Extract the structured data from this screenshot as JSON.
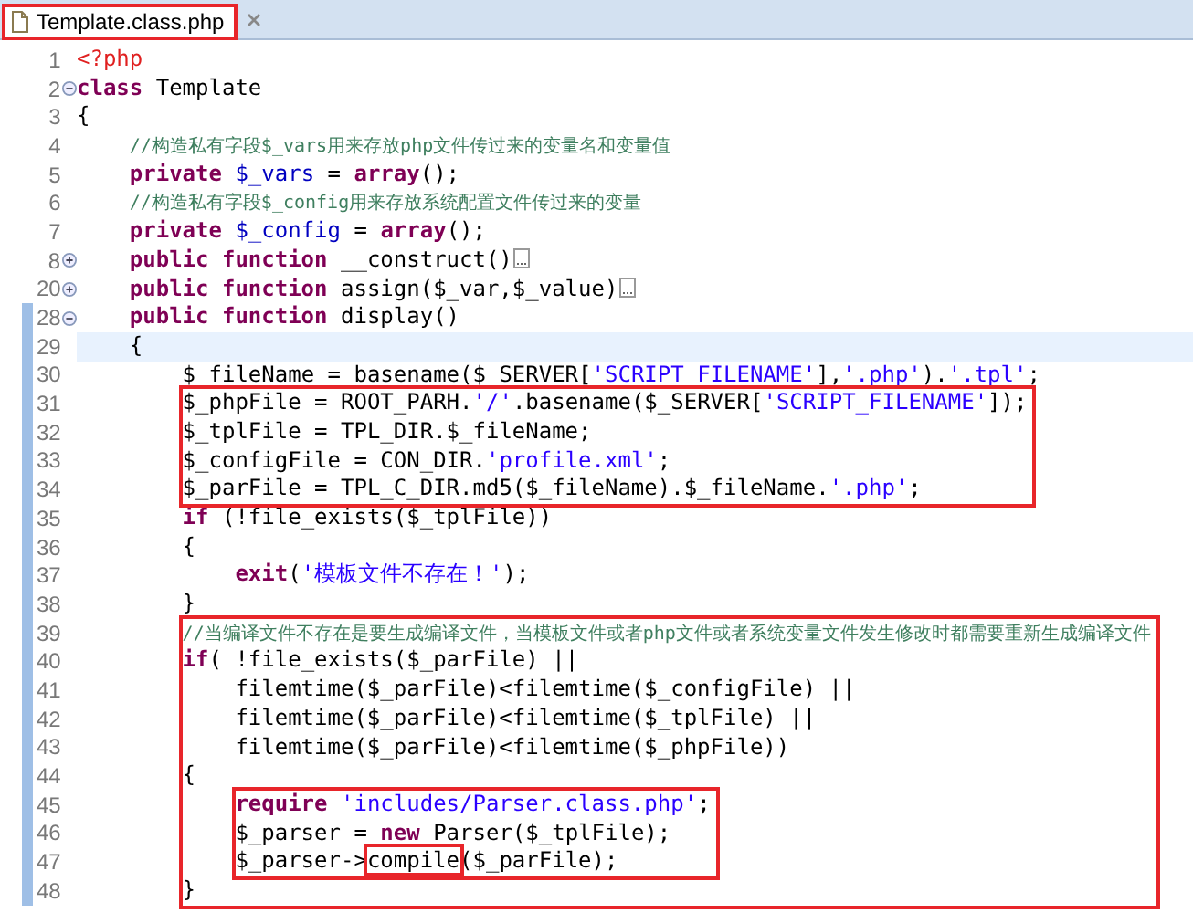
{
  "tab": {
    "label": "Template.class.php",
    "selected": true,
    "highlighted": true
  },
  "code": [
    {
      "kind": "line",
      "number": "1",
      "current": false,
      "changed": false,
      "tokens": [
        {
          "kind": "tag",
          "text": "<?php"
        }
      ]
    },
    {
      "kind": "line",
      "number": "2",
      "foldable": true,
      "folded": false,
      "current": false,
      "changed": false,
      "tokens": [
        {
          "kind": "kw",
          "text": "class"
        },
        {
          "kind": "p",
          "text": " Template"
        }
      ]
    },
    {
      "kind": "line",
      "number": "3",
      "current": false,
      "changed": false,
      "tokens": [
        {
          "kind": "p",
          "text": "{"
        }
      ]
    },
    {
      "kind": "line",
      "number": "4",
      "current": false,
      "changed": false,
      "tokens": [
        {
          "kind": "cmt",
          "text": "    //构造私有字段$_vars用来存放php文件传过来的变量名和变量值"
        }
      ]
    },
    {
      "kind": "line",
      "number": "5",
      "current": false,
      "changed": false,
      "tokens": [
        {
          "kind": "kw",
          "text": "    private"
        },
        {
          "kind": "var",
          "text": " $_vars"
        },
        {
          "kind": "p",
          "text": " = "
        },
        {
          "kind": "kw",
          "text": "array"
        },
        {
          "kind": "p",
          "text": "();"
        }
      ]
    },
    {
      "kind": "line",
      "number": "6",
      "current": false,
      "changed": false,
      "tokens": [
        {
          "kind": "cmt",
          "text": "    //构造私有字段$_config用来存放系统配置文件传过来的变量"
        }
      ]
    },
    {
      "kind": "line",
      "number": "7",
      "current": false,
      "changed": false,
      "tokens": [
        {
          "kind": "kw",
          "text": "    private"
        },
        {
          "kind": "var",
          "text": " $_config"
        },
        {
          "kind": "p",
          "text": " = "
        },
        {
          "kind": "kw",
          "text": "array"
        },
        {
          "kind": "p",
          "text": "();"
        }
      ]
    },
    {
      "kind": "line",
      "number": "8",
      "foldable": true,
      "folded": true,
      "current": false,
      "changed": false,
      "tokens": [
        {
          "kind": "kw",
          "text": "    public function"
        },
        {
          "kind": "p",
          "text": " __construct()"
        }
      ]
    },
    {
      "kind": "line",
      "number": "20",
      "foldable": true,
      "folded": true,
      "current": false,
      "changed": false,
      "tokens": [
        {
          "kind": "kw",
          "text": "    public function"
        },
        {
          "kind": "p",
          "text": " assign($_var,$_value)"
        }
      ]
    },
    {
      "kind": "line",
      "number": "28",
      "foldable": true,
      "folded": false,
      "current": false,
      "changed": true,
      "tokens": [
        {
          "kind": "kw",
          "text": "    public function"
        },
        {
          "kind": "p",
          "text": " display()"
        }
      ]
    },
    {
      "kind": "line",
      "number": "29",
      "current": true,
      "changed": true,
      "tokens": [
        {
          "kind": "p",
          "text": "    {"
        }
      ]
    },
    {
      "kind": "line",
      "number": "30",
      "current": false,
      "changed": true,
      "tokens": [
        {
          "kind": "p",
          "text": "        $ fileName = basename($ SERVER["
        },
        {
          "kind": "str",
          "text": "'SCRIPT FILENAME'"
        },
        {
          "kind": "p",
          "text": "],"
        },
        {
          "kind": "str",
          "text": "'.php'"
        },
        {
          "kind": "p",
          "text": ")."
        },
        {
          "kind": "str",
          "text": "'.tpl'"
        },
        {
          "kind": "p",
          "text": ";"
        }
      ]
    },
    {
      "kind": "box",
      "lines": [
        {
          "kind": "line",
          "number": "31",
          "current": false,
          "changed": true,
          "tokens": [
            {
              "kind": "p",
              "text": "        $_phpFile = ROOT_PARH."
            },
            {
              "kind": "str",
              "text": "'/'"
            },
            {
              "kind": "p",
              "text": ".basename($_SERVER["
            },
            {
              "kind": "str",
              "text": "'SCRIPT_FILENAME'"
            },
            {
              "kind": "p",
              "text": "]);"
            }
          ]
        },
        {
          "kind": "line",
          "number": "32",
          "current": false,
          "changed": true,
          "tokens": [
            {
              "kind": "p",
              "text": "        $_tplFile = TPL_DIR.$_fileName;"
            }
          ]
        },
        {
          "kind": "line",
          "number": "33",
          "current": false,
          "changed": true,
          "tokens": [
            {
              "kind": "p",
              "text": "        $_configFile = CON_DIR."
            },
            {
              "kind": "str",
              "text": "'profile.xml'"
            },
            {
              "kind": "p",
              "text": ";"
            }
          ]
        },
        {
          "kind": "line",
          "number": "34",
          "current": false,
          "changed": true,
          "tokens": [
            {
              "kind": "p",
              "text": "        $_parFile = TPL_C_DIR.md5($_fileName).$_fileName."
            },
            {
              "kind": "str",
              "text": "'.php'"
            },
            {
              "kind": "p",
              "text": ";"
            }
          ]
        }
      ]
    },
    {
      "kind": "line",
      "number": "35",
      "current": false,
      "changed": true,
      "tokens": [
        {
          "kind": "kw",
          "text": "        if"
        },
        {
          "kind": "p",
          "text": " (!file_exists($_tplFile))"
        }
      ]
    },
    {
      "kind": "line",
      "number": "36",
      "current": false,
      "changed": true,
      "tokens": [
        {
          "kind": "p",
          "text": "        {"
        }
      ]
    },
    {
      "kind": "line",
      "number": "37",
      "current": false,
      "changed": true,
      "tokens": [
        {
          "kind": "kw",
          "text": "            exit"
        },
        {
          "kind": "p",
          "text": "("
        },
        {
          "kind": "str",
          "text": "'模板文件不存在！'"
        },
        {
          "kind": "p",
          "text": ");"
        }
      ]
    },
    {
      "kind": "line",
      "number": "38",
      "current": false,
      "changed": true,
      "tokens": [
        {
          "kind": "p",
          "text": "        }"
        }
      ]
    },
    {
      "kind": "box",
      "lines": [
        {
          "kind": "line",
          "number": "39",
          "current": false,
          "changed": true,
          "tokens": [
            {
              "kind": "cmt",
              "text": "        //当编译文件不存在是要生成编译文件，当模板文件或者php文件或者系统变量文件发生修改时都需要重新生成编译文件"
            }
          ]
        },
        {
          "kind": "line",
          "number": "40",
          "current": false,
          "changed": true,
          "tokens": [
            {
              "kind": "kw",
              "text": "        if"
            },
            {
              "kind": "p",
              "text": "( !file_exists($_parFile) ||"
            }
          ]
        },
        {
          "kind": "line",
          "number": "41",
          "current": false,
          "changed": true,
          "tokens": [
            {
              "kind": "p",
              "text": "            filemtime($_parFile)<filemtime($_configFile) ||"
            }
          ]
        },
        {
          "kind": "line",
          "number": "42",
          "current": false,
          "changed": true,
          "tokens": [
            {
              "kind": "p",
              "text": "            filemtime($_parFile)<filemtime($_tplFile) ||"
            }
          ]
        },
        {
          "kind": "line",
          "number": "43",
          "current": false,
          "changed": true,
          "tokens": [
            {
              "kind": "p",
              "text": "            filemtime($_parFile)<filemtime($_phpFile))"
            }
          ]
        },
        {
          "kind": "line",
          "number": "44",
          "current": false,
          "changed": true,
          "tokens": [
            {
              "kind": "p",
              "text": "        {"
            }
          ]
        },
        {
          "kind": "box",
          "lines": [
            {
              "kind": "line",
              "number": "45",
              "current": false,
              "changed": true,
              "tokens": [
                {
                  "kind": "kw",
                  "text": "            require"
                },
                {
                  "kind": "str",
                  "text": " 'includes/Parser.class.php'"
                },
                {
                  "kind": "p",
                  "text": ";"
                }
              ]
            },
            {
              "kind": "line",
              "number": "46",
              "current": false,
              "changed": true,
              "tokens": [
                {
                  "kind": "p",
                  "text": "            $_parser = "
                },
                {
                  "kind": "kw",
                  "text": "new"
                },
                {
                  "kind": "p",
                  "text": " Parser($_tplFile);"
                }
              ]
            },
            {
              "kind": "line",
              "number": "47",
              "current": false,
              "changed": true,
              "tokens": [
                {
                  "kind": "p",
                  "text": "            $_parser->"
                },
                {
                  "kind": "p",
                  "text": "compile",
                  "boxed": true
                },
                {
                  "kind": "p",
                  "text": "($_parFile);"
                }
              ]
            }
          ]
        },
        {
          "kind": "line",
          "number": "48",
          "current": false,
          "changed": true,
          "tokens": [
            {
              "kind": "p",
              "text": "        }"
            }
          ]
        }
      ]
    }
  ]
}
